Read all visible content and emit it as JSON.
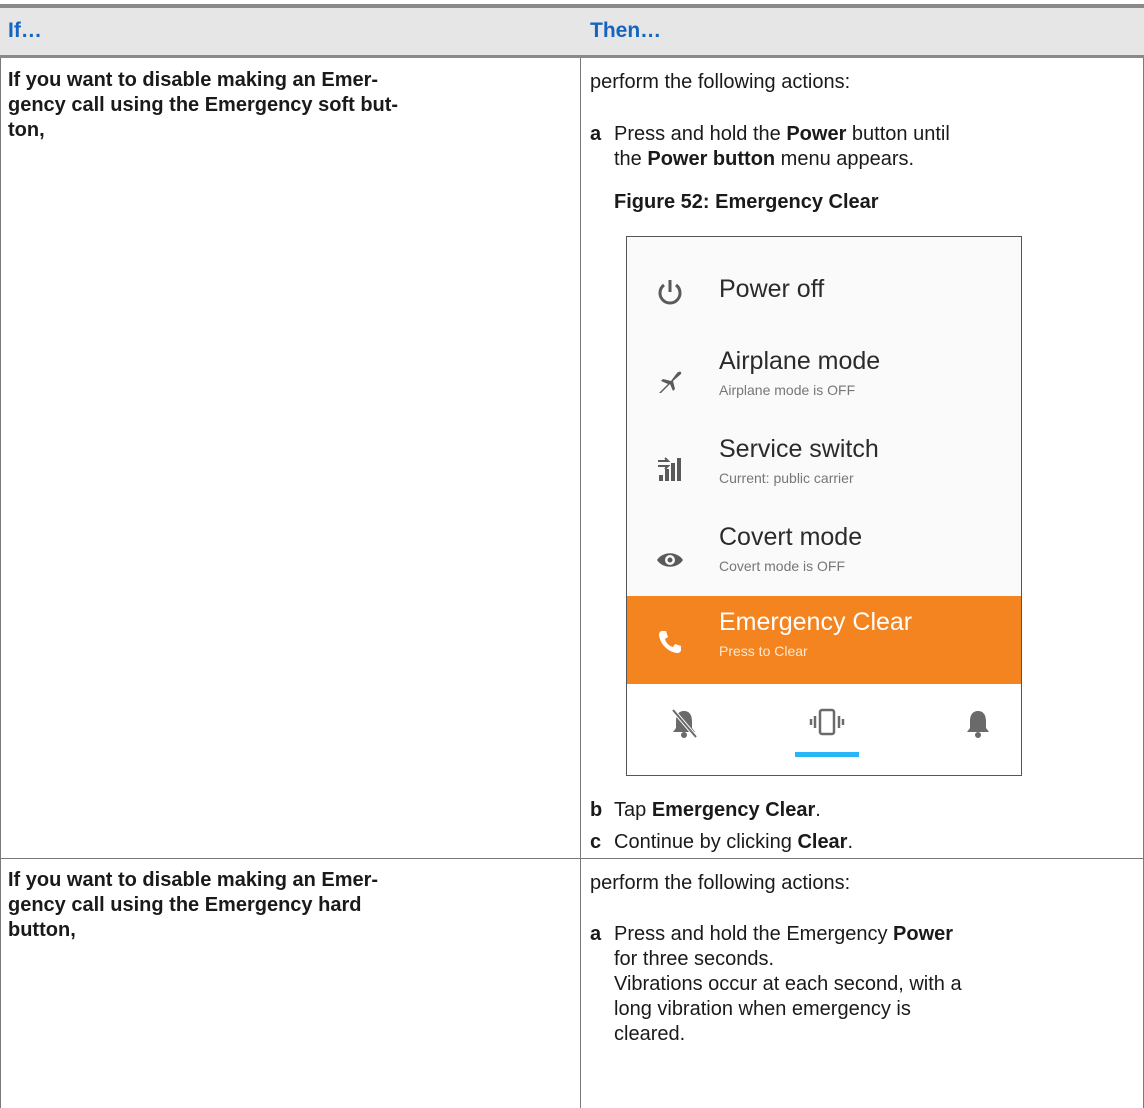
{
  "table": {
    "header": {
      "if": "If…",
      "then": "Then…"
    },
    "rows": [
      {
        "condition_lines": [
          "If you want to disable making an Emer-",
          "gency call using the Emergency soft but-",
          "ton,"
        ],
        "intro": "perform the following actions:",
        "step_a": {
          "letter": "a",
          "t1": "Press and hold the ",
          "b1": "Power",
          "t2": " button until",
          "t3": "the ",
          "b2": "Power button",
          "t4": " menu appears."
        },
        "figure_title": "Figure 52: Emergency Clear",
        "figure": {
          "items": [
            {
              "title": "Power off",
              "subtitle": "",
              "icon": "power-icon"
            },
            {
              "title": "Airplane mode",
              "subtitle": "Airplane mode is OFF",
              "icon": "airplane-icon"
            },
            {
              "title": "Service switch",
              "subtitle": "Current: public carrier",
              "icon": "service-switch-icon"
            },
            {
              "title": "Covert mode",
              "subtitle": "Covert mode is OFF",
              "icon": "eye-icon"
            },
            {
              "title": "Emergency Clear",
              "subtitle": "Press to Clear",
              "icon": "phone-icon"
            }
          ],
          "accent_color": "#f4841f",
          "selected_sound_mode": "vibrate"
        },
        "step_b": {
          "letter": "b",
          "t1": "Tap ",
          "b1": "Emergency Clear",
          "t2": "."
        },
        "step_c": {
          "letter": "c",
          "t1": "Continue by clicking ",
          "b1": "Clear",
          "t2": "."
        }
      },
      {
        "condition_lines": [
          "If you want to disable making an Emer-",
          "gency call using the Emergency hard",
          "button,"
        ],
        "intro": "perform the following actions:",
        "step_a": {
          "letter": "a",
          "t1": "Press and hold the Emergency ",
          "b1": "Power",
          "l2": "for three seconds.",
          "l3": "Vibrations occur at each second, with a",
          "l4": "long vibration when emergency is",
          "l5": "cleared."
        }
      }
    ]
  }
}
